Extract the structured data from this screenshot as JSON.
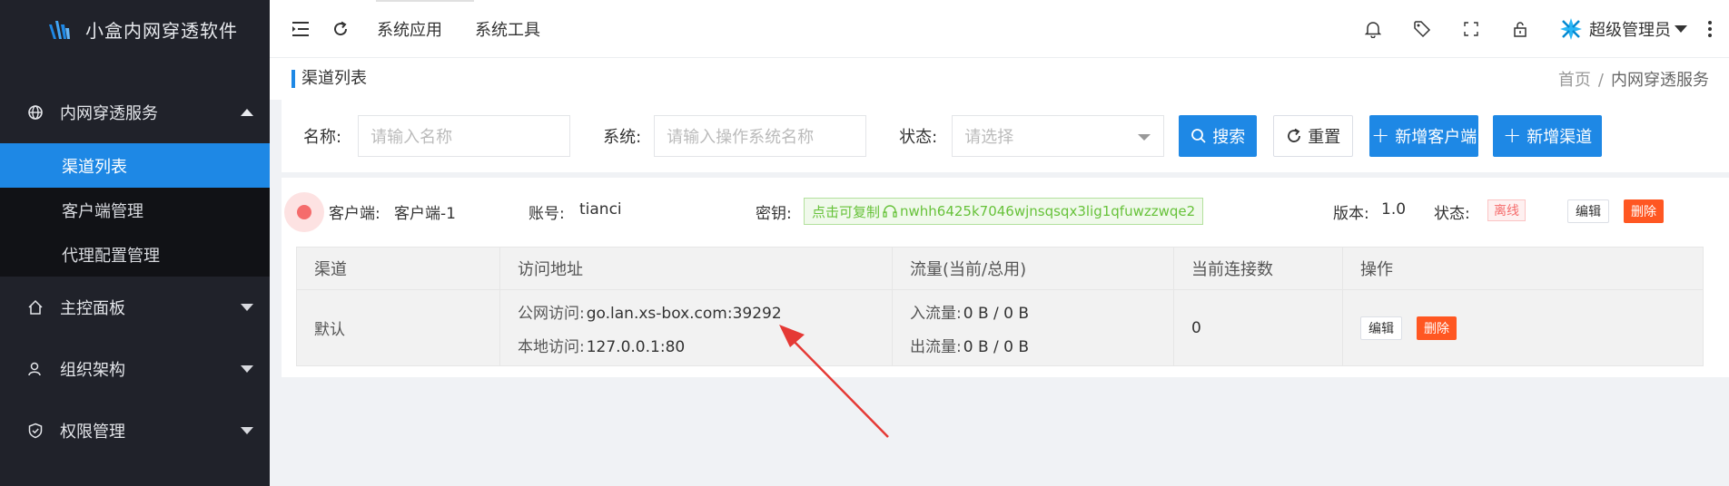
{
  "app": {
    "title": "小盒内网穿透软件"
  },
  "sidebar": {
    "items": [
      {
        "label": "内网穿透服务",
        "icon": "globe-icon",
        "expanded": true,
        "children": [
          {
            "label": "渠道列表",
            "active": true
          },
          {
            "label": "客户端管理"
          },
          {
            "label": "代理配置管理"
          }
        ]
      },
      {
        "label": "主控面板",
        "icon": "home-icon"
      },
      {
        "label": "组织架构",
        "icon": "users-icon"
      },
      {
        "label": "权限管理",
        "icon": "shield-icon"
      }
    ]
  },
  "topbar": {
    "nav": [
      "系统应用",
      "系统工具"
    ],
    "user": "超级管理员"
  },
  "breadcrumb": {
    "title": "渠道列表",
    "home": "首页",
    "sep": "/",
    "current": "内网穿透服务"
  },
  "search": {
    "name_label": "名称:",
    "name_placeholder": "请输入名称",
    "system_label": "系统:",
    "system_placeholder": "请输入操作系统名称",
    "status_label": "状态:",
    "status_placeholder": "请选择",
    "search_btn": "搜索",
    "reset_btn": "重置",
    "add_client_btn": "新增客户端",
    "add_channel_btn": "新增渠道"
  },
  "client": {
    "client_label": "客户端:",
    "client_name": "客户端-1",
    "account_label": "账号:",
    "account": "tianci",
    "key_label": "密钥:",
    "copy_hint": "点击可复制",
    "key": "nwhh6425k7046wjnsqsqx3lig1qfuwzzwqe2",
    "version_label": "版本:",
    "version": "1.0",
    "status_label": "状态:",
    "status": "离线",
    "edit": "编辑",
    "delete": "删除"
  },
  "table": {
    "headers": [
      "渠道",
      "访问地址",
      "流量(当前/总用)",
      "当前连接数",
      "操作"
    ],
    "rows": [
      {
        "channel": "默认",
        "public_label": "公网访问:",
        "public_addr": "go.lan.xs-box.com:39292",
        "local_label": "本地访问:",
        "local_addr": "127.0.0.1:80",
        "in_label": "入流量:",
        "in_value": "0 B / 0 B",
        "out_label": "出流量:",
        "out_value": "0 B / 0 B",
        "connections": "0",
        "edit": "编辑",
        "delete": "删除"
      }
    ]
  },
  "colors": {
    "accent": "#1e88e5",
    "sidebar_bg": "#20222a",
    "danger": "#ff5722",
    "success": "#67c23a",
    "annotation": "#e53935"
  }
}
